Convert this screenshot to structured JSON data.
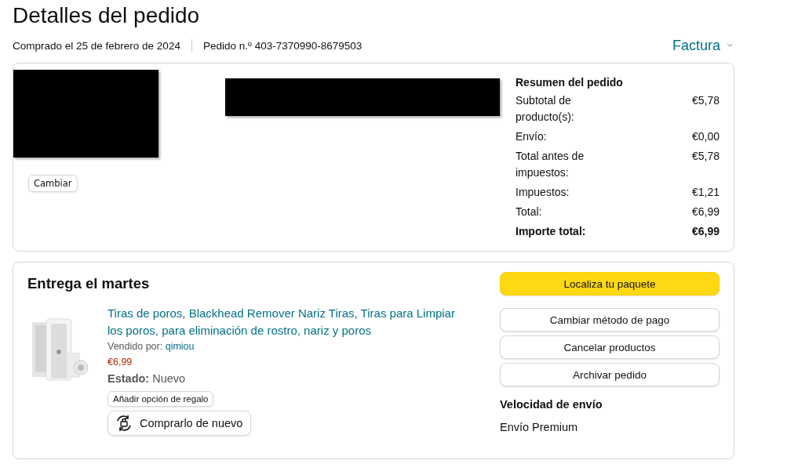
{
  "title": "Detalles del pedido",
  "meta": {
    "purchased": "Comprado el 25 de febrero de 2024",
    "order_number": "Pedido n.º 403-7370990-8679503",
    "invoice": "Factura"
  },
  "address": {
    "change_button": "Cambiar"
  },
  "summary": {
    "heading": "Resumen del pedido",
    "rows": [
      {
        "label": "Subtotal de producto(s):",
        "value": "€5,78",
        "bold": false
      },
      {
        "label": "Envío:",
        "value": "€0,00",
        "bold": false
      },
      {
        "label": "Total antes de impuestos:",
        "value": "€5,78",
        "bold": false
      },
      {
        "label": "Impuestos:",
        "value": "€1,21",
        "bold": false
      },
      {
        "label": "Total:",
        "value": "€6,99",
        "bold": false
      },
      {
        "label": "Importe total:",
        "value": "€6,99",
        "bold": true
      }
    ]
  },
  "delivery": {
    "heading": "Entrega el martes",
    "product": {
      "title": "Tiras de poros, Blackhead Remover Nariz Tiras, Tiras para Limpiar los poros, para eliminación de rostro, nariz y poros",
      "sold_by_label": "Vendido por:",
      "seller": "qimiou",
      "price": "€6,99",
      "condition_label": "Estado:",
      "condition": "Nuevo",
      "gift_button": "Añadir opción de regalo",
      "buy_again_button": "Comprarlo de nuevo"
    },
    "actions": [
      {
        "label": "Localiza tu paquete",
        "kind": "primary"
      },
      {
        "label": "Cambiar método de pago",
        "kind": "secondary"
      },
      {
        "label": "Cancelar productos",
        "kind": "secondary"
      },
      {
        "label": "Archivar pedido",
        "kind": "secondary"
      }
    ],
    "shipping_heading": "Velocidad de envío",
    "shipping_speed": "Envío Premium"
  }
}
